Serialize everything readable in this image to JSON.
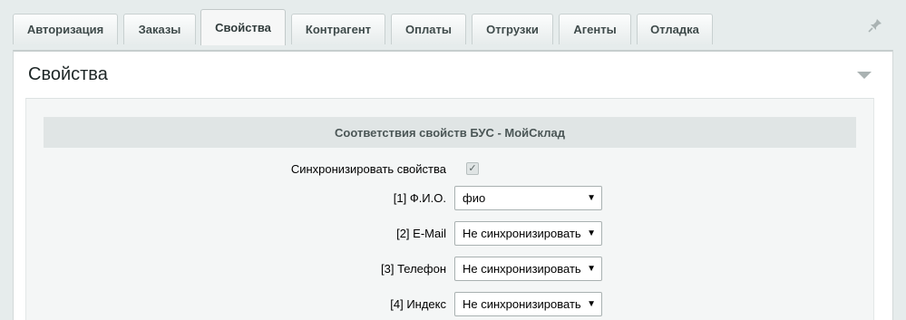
{
  "tabs": [
    {
      "label": "Авторизация"
    },
    {
      "label": "Заказы"
    },
    {
      "label": "Свойства"
    },
    {
      "label": "Контрагент"
    },
    {
      "label": "Оплаты"
    },
    {
      "label": "Отгрузки"
    },
    {
      "label": "Агенты"
    },
    {
      "label": "Отладка"
    }
  ],
  "active_tab": "Свойства",
  "panel": {
    "title": "Свойства"
  },
  "section": {
    "title": "Соответствия свойств БУС - МойСклад"
  },
  "sync": {
    "label": "Синхронизировать свойства",
    "checked": true,
    "check_glyph": "✓"
  },
  "properties": [
    {
      "label": "[1] Ф.И.О.",
      "value": "фио"
    },
    {
      "label": "[2] E-Mail",
      "value": "Не синхронизировать"
    },
    {
      "label": "[3] Телефон",
      "value": "Не синхронизировать"
    },
    {
      "label": "[4] Индекс",
      "value": "Не синхронизировать"
    }
  ],
  "icons": {
    "pin": "pin-icon",
    "collapse": "collapse-arrow-icon",
    "dropdown": "dropdown-arrow-icon"
  },
  "colors": {
    "background": "#e6ecec",
    "panel": "#ffffff",
    "section_head": "#e0e5e5"
  }
}
